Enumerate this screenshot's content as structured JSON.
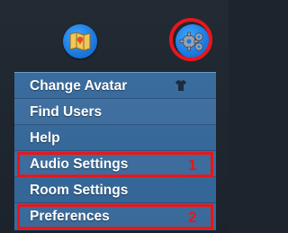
{
  "toolbar": {
    "map_button": {
      "icon": "map-icon",
      "color": "#1a78e0"
    },
    "settings_button": {
      "icon": "gear-icon",
      "color": "#1a78e0",
      "highlight_color": "#e8161b"
    }
  },
  "menu": {
    "background": "#336496",
    "items": [
      {
        "label": "Change Avatar",
        "icon": "shirt-icon"
      },
      {
        "label": "Find Users"
      },
      {
        "label": "Help"
      },
      {
        "label": "Audio Settings",
        "annotation": "1"
      },
      {
        "label": "Room Settings"
      },
      {
        "label": "Preferences",
        "annotation": "2"
      }
    ]
  },
  "annotation_color": "#e8161b"
}
